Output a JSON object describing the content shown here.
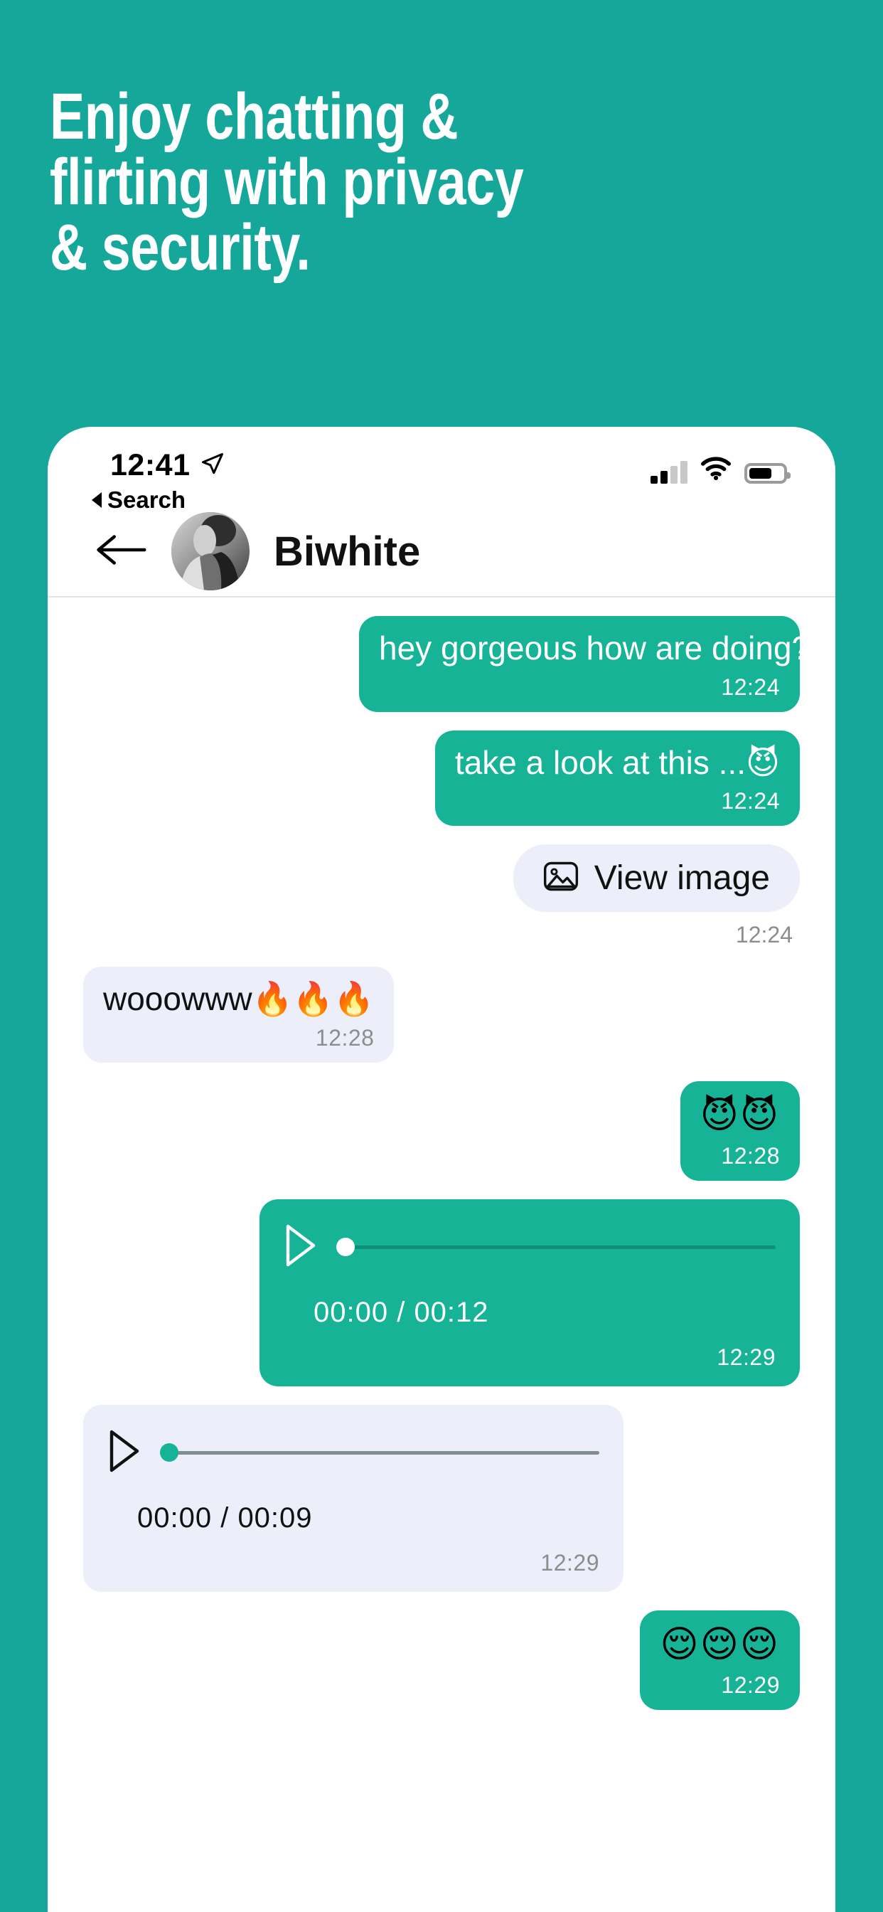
{
  "promo": {
    "headline": "Enjoy chatting &\nflirting with privacy\n& security."
  },
  "colors": {
    "background": "#16a79b",
    "bubble_out": "#16b396",
    "bubble_in": "#eceffa",
    "text_light": "#ffffff",
    "text_dark": "#111111",
    "stamp_muted": "#8d8d8d"
  },
  "status_bar": {
    "time": "12:41",
    "location_icon": "location-arrow-icon",
    "back_label": "Search",
    "signal_icon": "cellular-signal-icon",
    "signal_bars_filled": 2,
    "signal_bars_total": 4,
    "wifi_icon": "wifi-icon",
    "battery_icon": "battery-icon",
    "battery_percent": 68
  },
  "chat_header": {
    "back_icon": "back-arrow-icon",
    "avatar_icon": "avatar-image",
    "peer_name": "Biwhite"
  },
  "messages": [
    {
      "id": "msg-1",
      "direction": "out",
      "type": "text",
      "text": "hey gorgeous how are doing?",
      "time": "12:24"
    },
    {
      "id": "msg-2",
      "direction": "out",
      "type": "text",
      "text": "take a look at this ...",
      "emoji": "😈",
      "time": "12:24"
    },
    {
      "id": "msg-3",
      "direction": "out",
      "type": "image-attachment",
      "button_label": "View image",
      "icon": "photo-icon",
      "time": "12:24"
    },
    {
      "id": "msg-4",
      "direction": "in",
      "type": "text",
      "text": "wooowww",
      "emoji": "🔥🔥🔥",
      "time": "12:28"
    },
    {
      "id": "msg-5",
      "direction": "out",
      "type": "emoji",
      "emoji": "😈😈",
      "time": "12:28"
    },
    {
      "id": "msg-6",
      "direction": "out",
      "type": "audio",
      "play_icon": "play-icon",
      "position": "00:00",
      "duration": "00:12",
      "time_display": "00:00 / 00:12",
      "progress_percent": 0,
      "time": "12:29"
    },
    {
      "id": "msg-7",
      "direction": "in",
      "type": "audio",
      "play_icon": "play-icon",
      "position": "00:00",
      "duration": "00:09",
      "time_display": "00:00 / 00:09",
      "progress_percent": 0,
      "time": "12:29"
    },
    {
      "id": "msg-8",
      "direction": "out",
      "type": "emoji",
      "emoji": "😌😌😌",
      "time": "12:29"
    }
  ]
}
